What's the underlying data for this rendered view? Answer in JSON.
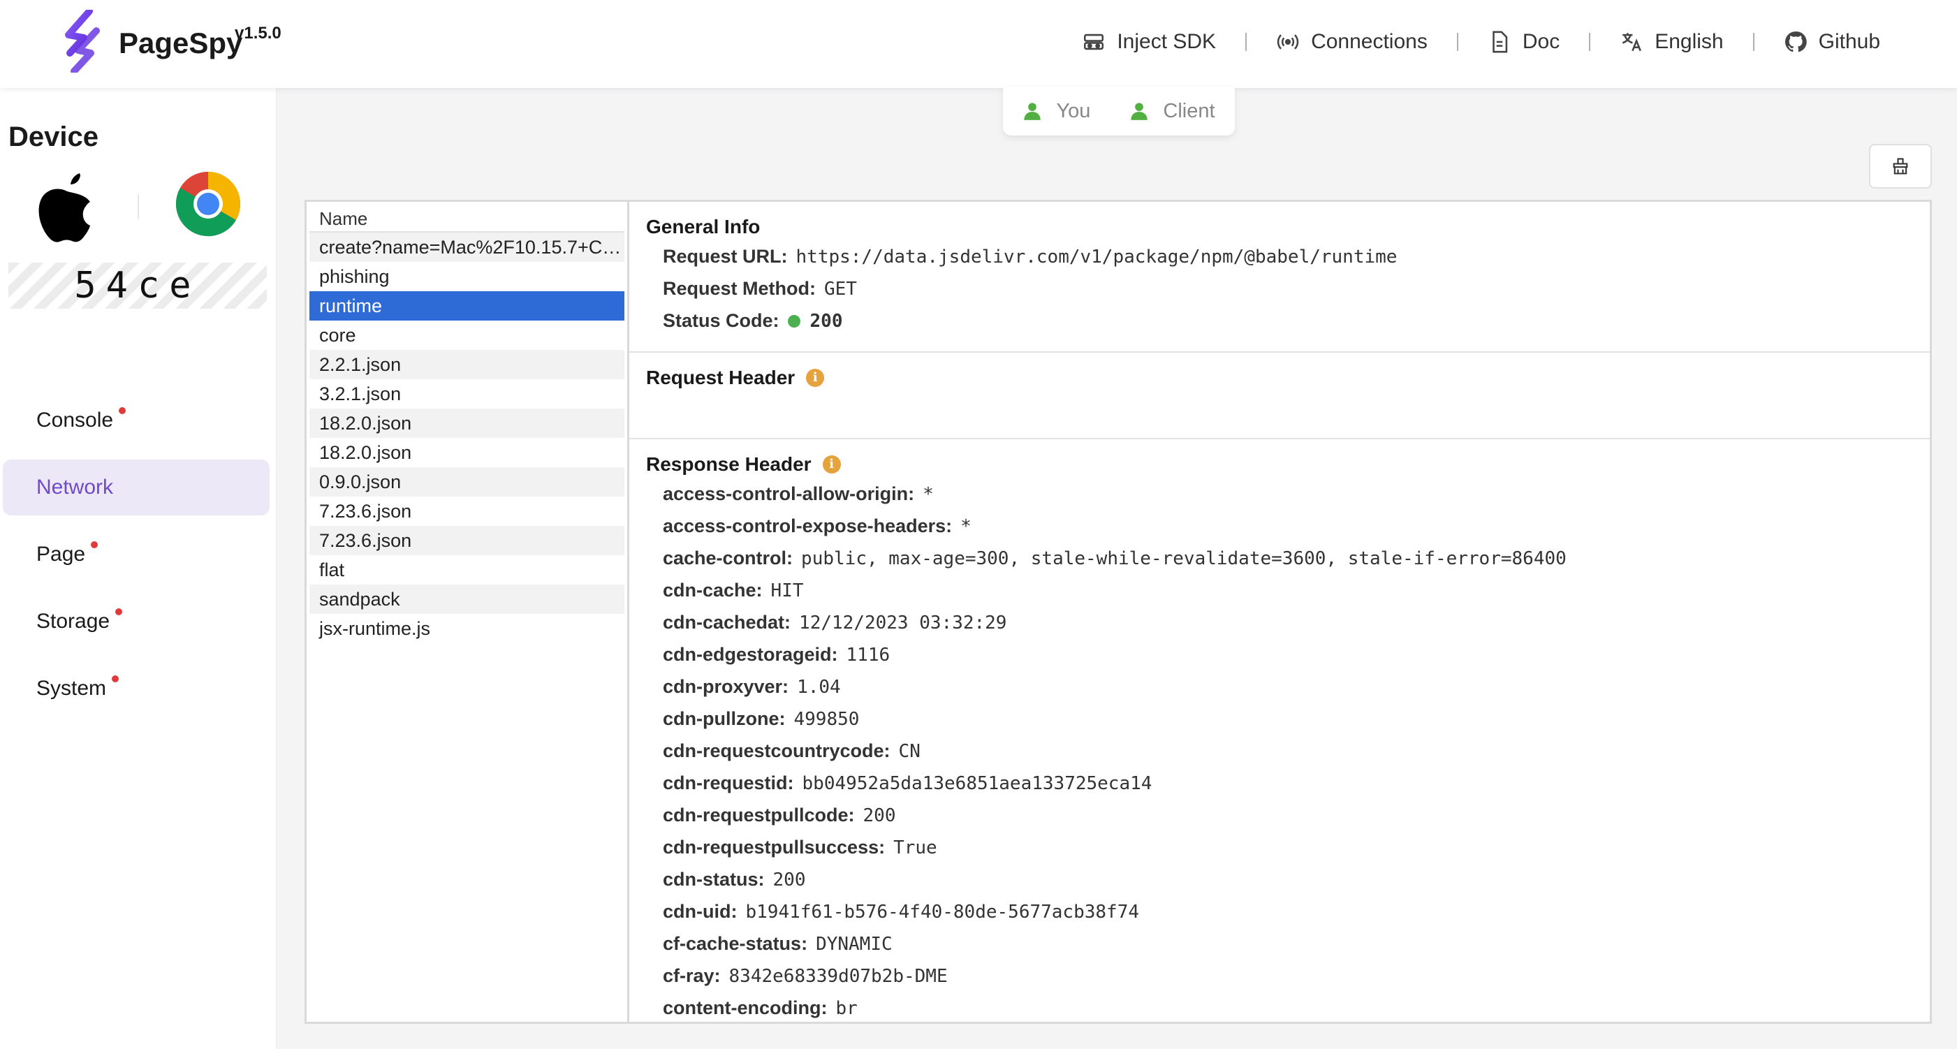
{
  "header": {
    "brand": "PageSpy",
    "version": "v1.5.0",
    "nav": [
      {
        "label": "Inject SDK",
        "icon": "inject-icon"
      },
      {
        "label": "Connections",
        "icon": "broadcast-icon"
      },
      {
        "label": "Doc",
        "icon": "document-icon"
      },
      {
        "label": "English",
        "icon": "translate-icon"
      },
      {
        "label": "Github",
        "icon": "github-icon"
      }
    ]
  },
  "sidebar": {
    "title": "Device",
    "device_id": "54ce",
    "items": [
      {
        "label": "Console",
        "dot": true
      },
      {
        "label": "Network",
        "dot": false,
        "active": true
      },
      {
        "label": "Page",
        "dot": true
      },
      {
        "label": "Storage",
        "dot": true
      },
      {
        "label": "System",
        "dot": true
      }
    ]
  },
  "mode": {
    "you": "You",
    "client": "Client"
  },
  "requests": {
    "header": "Name",
    "rows": [
      "create?name=Mac%2F10.15.7+Chr...",
      "phishing",
      "runtime",
      "core",
      "2.2.1.json",
      "3.2.1.json",
      "18.2.0.json",
      "18.2.0.json",
      "0.9.0.json",
      "7.23.6.json",
      "7.23.6.json",
      "flat",
      "sandpack",
      "jsx-runtime.js"
    ],
    "selected_index": 2
  },
  "detail": {
    "general": {
      "title": "General Info",
      "url_label": "Request URL:",
      "url": "https://data.jsdelivr.com/v1/package/npm/@babel/runtime",
      "method_label": "Request Method:",
      "method": "GET",
      "status_label": "Status Code:",
      "status": "200"
    },
    "request_header": {
      "title": "Request Header",
      "info": "i"
    },
    "response_header": {
      "title": "Response Header",
      "info": "i",
      "rows": [
        {
          "k": "access-control-allow-origin:",
          "v": "*"
        },
        {
          "k": "access-control-expose-headers:",
          "v": "*"
        },
        {
          "k": "cache-control:",
          "v": "public, max-age=300, stale-while-revalidate=3600, stale-if-error=86400"
        },
        {
          "k": "cdn-cache:",
          "v": "HIT"
        },
        {
          "k": "cdn-cachedat:",
          "v": "12/12/2023 03:32:29"
        },
        {
          "k": "cdn-edgestorageid:",
          "v": "1116"
        },
        {
          "k": "cdn-proxyver:",
          "v": "1.04"
        },
        {
          "k": "cdn-pullzone:",
          "v": "499850"
        },
        {
          "k": "cdn-requestcountrycode:",
          "v": "CN"
        },
        {
          "k": "cdn-requestid:",
          "v": "bb04952a5da13e6851aea133725eca14"
        },
        {
          "k": "cdn-requestpullcode:",
          "v": "200"
        },
        {
          "k": "cdn-requestpullsuccess:",
          "v": "True"
        },
        {
          "k": "cdn-status:",
          "v": "200"
        },
        {
          "k": "cdn-uid:",
          "v": "b1941f61-b576-4f40-80de-5677acb38f74"
        },
        {
          "k": "cf-cache-status:",
          "v": "DYNAMIC"
        },
        {
          "k": "cf-ray:",
          "v": "8342e68339d07b2b-DME"
        },
        {
          "k": "content-encoding:",
          "v": "br"
        }
      ]
    }
  },
  "colors": {
    "accent": "#6f4bc7",
    "selected": "#2f6bd6",
    "status_ok": "#4caf50",
    "info": "#e6a23c"
  }
}
